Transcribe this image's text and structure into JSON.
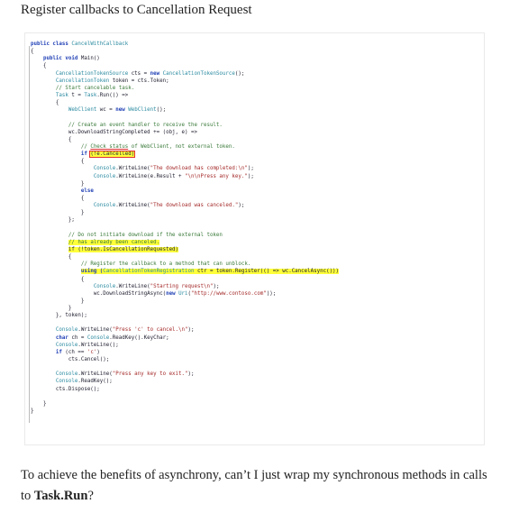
{
  "heading": "Register callbacks to Cancellation Request",
  "code_lines": [
    {
      "indent": 0,
      "parts": [
        {
          "t": "public class ",
          "c": "kw"
        },
        {
          "t": "CancelWithCallback",
          "c": "ty"
        }
      ]
    },
    {
      "indent": 0,
      "parts": [
        {
          "t": "{",
          "c": ""
        }
      ]
    },
    {
      "indent": 1,
      "parts": [
        {
          "t": "public void ",
          "c": "kw"
        },
        {
          "t": "Main()",
          "c": ""
        }
      ]
    },
    {
      "indent": 1,
      "parts": [
        {
          "t": "{",
          "c": ""
        }
      ]
    },
    {
      "indent": 2,
      "parts": [
        {
          "t": "CancellationTokenSource",
          "c": "ty"
        },
        {
          "t": " cts = ",
          "c": ""
        },
        {
          "t": "new ",
          "c": "kw"
        },
        {
          "t": "CancellationTokenSource",
          "c": "ty"
        },
        {
          "t": "();",
          "c": ""
        }
      ]
    },
    {
      "indent": 2,
      "parts": [
        {
          "t": "CancellationToken",
          "c": "ty"
        },
        {
          "t": " token = cts.Token;",
          "c": ""
        }
      ]
    },
    {
      "indent": 2,
      "parts": [
        {
          "t": "// Start cancelable task.",
          "c": "cm"
        }
      ]
    },
    {
      "indent": 2,
      "parts": [
        {
          "t": "Task",
          "c": "ty"
        },
        {
          "t": " t = ",
          "c": ""
        },
        {
          "t": "Task",
          "c": "ty"
        },
        {
          "t": ".Run(() =>",
          "c": ""
        }
      ]
    },
    {
      "indent": 2,
      "parts": [
        {
          "t": "{",
          "c": ""
        }
      ]
    },
    {
      "indent": 3,
      "parts": [
        {
          "t": "WebClient",
          "c": "ty"
        },
        {
          "t": " wc = ",
          "c": ""
        },
        {
          "t": "new ",
          "c": "kw"
        },
        {
          "t": "WebClient",
          "c": "ty"
        },
        {
          "t": "();",
          "c": ""
        }
      ]
    },
    {
      "indent": 3,
      "parts": [
        {
          "t": "",
          "c": ""
        }
      ]
    },
    {
      "indent": 3,
      "parts": [
        {
          "t": "// Create an event handler to receive the result.",
          "c": "cm"
        }
      ]
    },
    {
      "indent": 3,
      "parts": [
        {
          "t": "wc.DownloadStringCompleted += (obj, e) =>",
          "c": ""
        }
      ]
    },
    {
      "indent": 3,
      "parts": [
        {
          "t": "{",
          "c": ""
        }
      ]
    },
    {
      "indent": 4,
      "parts": [
        {
          "t": "// ",
          "c": "cm"
        },
        {
          "t": "Check status",
          "c": "cm ul-r"
        },
        {
          "t": " of WebClient, not external token.",
          "c": "cm"
        }
      ]
    },
    {
      "indent": 4,
      "parts": [
        {
          "t": "if ",
          "c": "kw"
        },
        {
          "t": "(!e.Cancelled)",
          "c": "hl-y box-r"
        }
      ]
    },
    {
      "indent": 4,
      "parts": [
        {
          "t": "{",
          "c": ""
        }
      ]
    },
    {
      "indent": 5,
      "parts": [
        {
          "t": "Console",
          "c": "ty"
        },
        {
          "t": ".WriteLine(",
          "c": ""
        },
        {
          "t": "\"The download has completed:\\n\"",
          "c": "st"
        },
        {
          "t": ");",
          "c": ""
        }
      ]
    },
    {
      "indent": 5,
      "parts": [
        {
          "t": "Console",
          "c": "ty"
        },
        {
          "t": ".WriteLine(e.Result + ",
          "c": ""
        },
        {
          "t": "\"\\n\\nPress any key.\"",
          "c": "st"
        },
        {
          "t": ");",
          "c": ""
        }
      ]
    },
    {
      "indent": 4,
      "parts": [
        {
          "t": "}",
          "c": ""
        }
      ]
    },
    {
      "indent": 4,
      "parts": [
        {
          "t": "else",
          "c": "kw"
        }
      ]
    },
    {
      "indent": 4,
      "parts": [
        {
          "t": "{",
          "c": ""
        }
      ]
    },
    {
      "indent": 5,
      "parts": [
        {
          "t": "Console",
          "c": "ty"
        },
        {
          "t": ".WriteLine(",
          "c": ""
        },
        {
          "t": "\"The download was canceled.\"",
          "c": "st"
        },
        {
          "t": ");",
          "c": ""
        }
      ]
    },
    {
      "indent": 4,
      "parts": [
        {
          "t": "}",
          "c": ""
        }
      ]
    },
    {
      "indent": 3,
      "parts": [
        {
          "t": "};",
          "c": ""
        }
      ]
    },
    {
      "indent": 3,
      "parts": [
        {
          "t": "",
          "c": ""
        }
      ]
    },
    {
      "indent": 3,
      "parts": [
        {
          "t": "// Do not initiate download if the external token",
          "c": "cm"
        }
      ]
    },
    {
      "indent": 3,
      "parts": [
        {
          "t": "// has already been canceled.",
          "c": "cm hl-y"
        }
      ]
    },
    {
      "indent": 3,
      "parts": [
        {
          "t": "if (!token.IsCancellationRequested)",
          "c": "hl-y"
        }
      ]
    },
    {
      "indent": 3,
      "parts": [
        {
          "t": "{",
          "c": ""
        }
      ]
    },
    {
      "indent": 4,
      "parts": [
        {
          "t": "// Register the callback to a method that can unblock.",
          "c": "cm"
        }
      ]
    },
    {
      "indent": 4,
      "parts": [
        {
          "t": "using (",
          "c": "kw hl-y"
        },
        {
          "t": "CancellationTokenRegistration",
          "c": "ty hl-y"
        },
        {
          "t": " ctr = token.Register(() => wc.CancelAsync()))",
          "c": "hl-y"
        }
      ]
    },
    {
      "indent": 4,
      "parts": [
        {
          "t": "{",
          "c": ""
        }
      ]
    },
    {
      "indent": 5,
      "parts": [
        {
          "t": "Console",
          "c": "ty"
        },
        {
          "t": ".WriteLine(",
          "c": ""
        },
        {
          "t": "\"Starting request\\n\"",
          "c": "st"
        },
        {
          "t": ");",
          "c": ""
        }
      ]
    },
    {
      "indent": 5,
      "parts": [
        {
          "t": "wc.DownloadStringAsync(",
          "c": ""
        },
        {
          "t": "new ",
          "c": "kw"
        },
        {
          "t": "Uri",
          "c": "ty"
        },
        {
          "t": "(",
          "c": ""
        },
        {
          "t": "\"http://www.contoso.com\"",
          "c": "st"
        },
        {
          "t": "));",
          "c": ""
        }
      ]
    },
    {
      "indent": 4,
      "parts": [
        {
          "t": "}",
          "c": ""
        }
      ]
    },
    {
      "indent": 3,
      "parts": [
        {
          "t": "}",
          "c": ""
        }
      ]
    },
    {
      "indent": 2,
      "parts": [
        {
          "t": "}, token);",
          "c": ""
        }
      ]
    },
    {
      "indent": 2,
      "parts": [
        {
          "t": "",
          "c": ""
        }
      ]
    },
    {
      "indent": 2,
      "parts": [
        {
          "t": "Console",
          "c": "ty"
        },
        {
          "t": ".WriteLine(",
          "c": ""
        },
        {
          "t": "\"Press 'c' to cancel.\\n\"",
          "c": "st"
        },
        {
          "t": ");",
          "c": ""
        }
      ]
    },
    {
      "indent": 2,
      "parts": [
        {
          "t": "char",
          "c": "kw"
        },
        {
          "t": " ch = ",
          "c": ""
        },
        {
          "t": "Console",
          "c": "ty"
        },
        {
          "t": ".ReadKey().KeyChar;",
          "c": ""
        }
      ]
    },
    {
      "indent": 2,
      "parts": [
        {
          "t": "Console",
          "c": "ty"
        },
        {
          "t": ".WriteLine();",
          "c": ""
        }
      ]
    },
    {
      "indent": 2,
      "parts": [
        {
          "t": "if",
          "c": "kw"
        },
        {
          "t": " (ch == ",
          "c": ""
        },
        {
          "t": "'c'",
          "c": "st"
        },
        {
          "t": ")",
          "c": ""
        }
      ]
    },
    {
      "indent": 3,
      "parts": [
        {
          "t": "cts.Cancel();",
          "c": ""
        }
      ]
    },
    {
      "indent": 2,
      "parts": [
        {
          "t": "",
          "c": ""
        }
      ]
    },
    {
      "indent": 2,
      "parts": [
        {
          "t": "Console",
          "c": "ty"
        },
        {
          "t": ".WriteLine(",
          "c": ""
        },
        {
          "t": "\"Press any key to exit.\"",
          "c": "st"
        },
        {
          "t": ");",
          "c": ""
        }
      ]
    },
    {
      "indent": 2,
      "parts": [
        {
          "t": "Console",
          "c": "ty"
        },
        {
          "t": ".ReadKey();",
          "c": ""
        }
      ]
    },
    {
      "indent": 2,
      "parts": [
        {
          "t": "cts.Dispose();",
          "c": ""
        }
      ]
    },
    {
      "indent": 1,
      "parts": [
        {
          "t": "",
          "c": ""
        }
      ]
    },
    {
      "indent": 1,
      "parts": [
        {
          "t": "}",
          "c": ""
        }
      ]
    },
    {
      "indent": 0,
      "parts": [
        {
          "t": "}",
          "c": ""
        }
      ]
    }
  ],
  "paragraph": {
    "before": "To achieve the benefits of asynchrony, can’t I just wrap my synchronous methods in calls to ",
    "bold": "Task.Run",
    "after": "?"
  }
}
